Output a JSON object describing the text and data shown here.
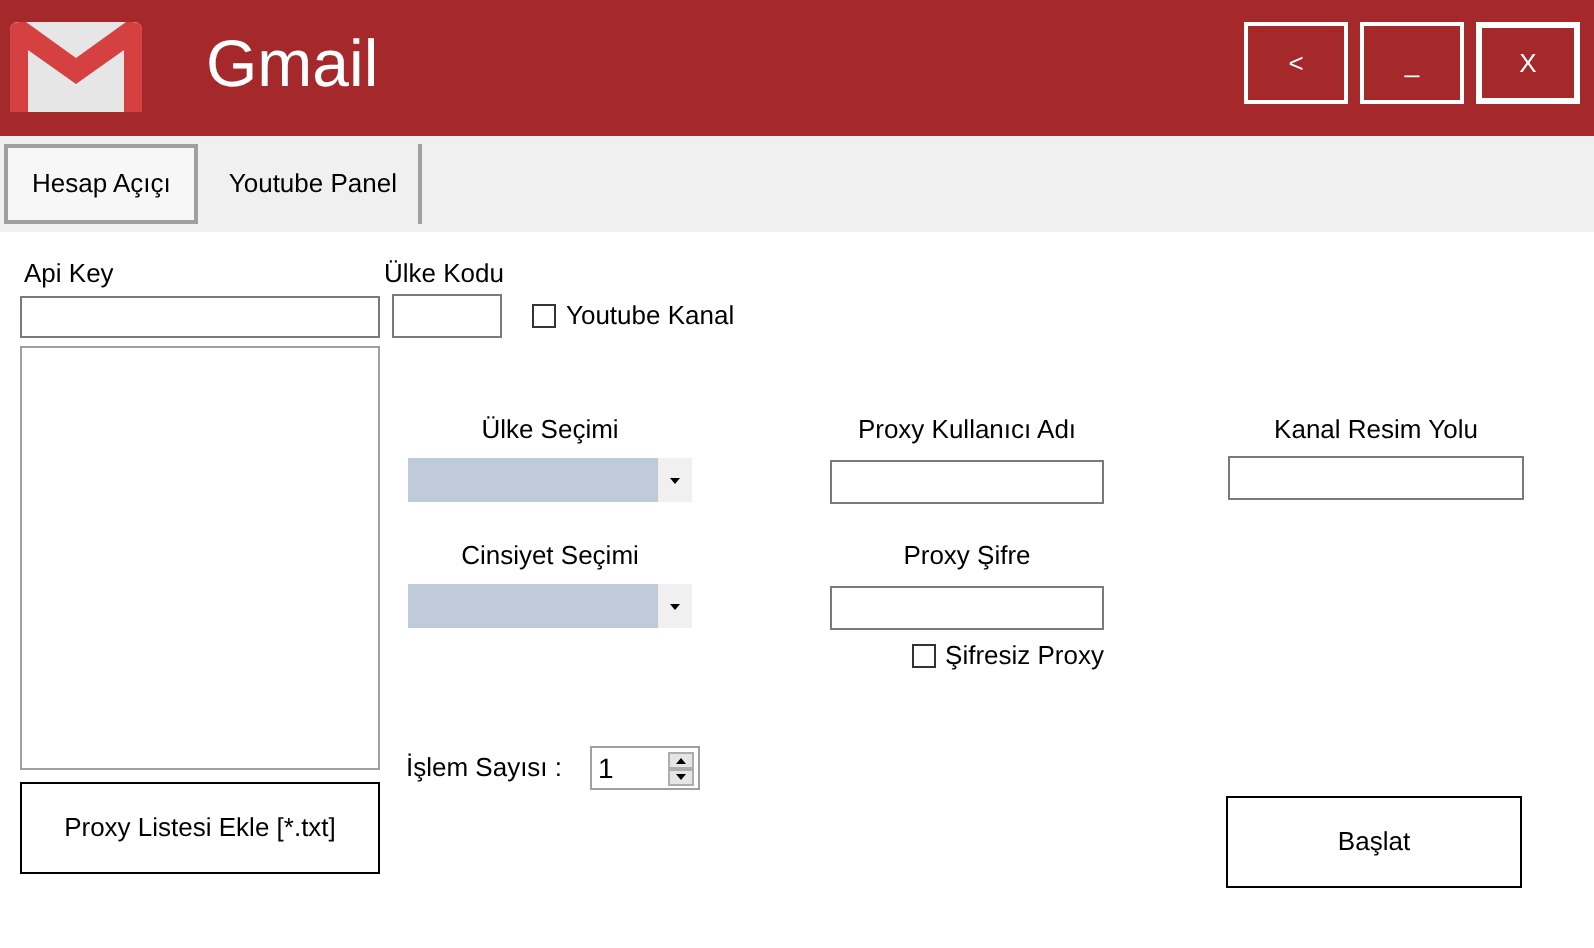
{
  "window": {
    "title": "Gmail",
    "buttons": [
      "<",
      "_",
      "X"
    ]
  },
  "tabs": [
    {
      "label": "Hesap Açıçı",
      "selected": true
    },
    {
      "label": "Youtube Panel",
      "selected": false
    }
  ],
  "api_key": {
    "label": "Api Key"
  },
  "country_code": {
    "label": "Ülke Kodu"
  },
  "youtube_channel": {
    "label": "Youtube Kanal",
    "checked": false
  },
  "country_select": {
    "label": "Ülke Seçimi"
  },
  "gender_select": {
    "label": "Cinsiyet Seçimi"
  },
  "proxy_user": {
    "label": "Proxy Kullanıcı Adı"
  },
  "proxy_password": {
    "label": "Proxy Şifre"
  },
  "no_password_proxy": {
    "label": "Şifresiz Proxy",
    "checked": false
  },
  "channel_image_path": {
    "label": "Kanal Resim Yolu"
  },
  "operation_count": {
    "label": "İşlem Sayısı :",
    "value": "1"
  },
  "buttons": [
    "Proxy Listesi Ekle [*.txt]",
    "Başlat"
  ]
}
